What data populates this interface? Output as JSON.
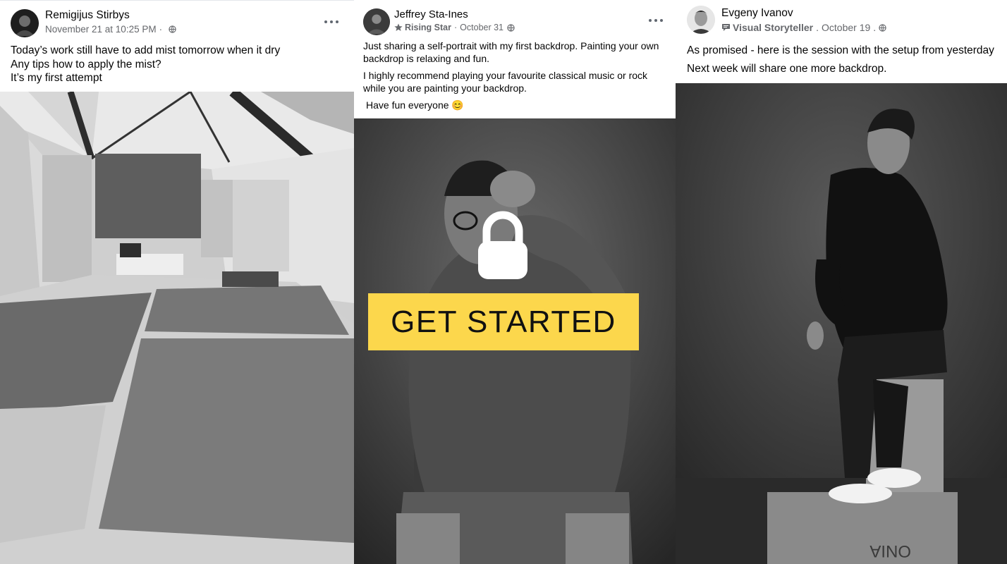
{
  "posts": [
    {
      "author": "Remigijus Stirbys",
      "timestamp": "November 21 at 10:25 PM",
      "separator": "·",
      "privacy_icon": "globe-icon",
      "more_icon": "more-options-icon",
      "lines": [
        "Today’s work still have to add mist tomorrow when it dry",
        "Any tips how to apply the mist?",
        "It’s my first attempt"
      ],
      "photo": "studio-floor-backdrop-photo"
    },
    {
      "author": "Jeffrey Sta-Ines",
      "badge_icon": "star-icon",
      "badge": "Rising Star",
      "separator": "·",
      "timestamp": "October 31",
      "privacy_icon": "globe-icon",
      "more_icon": "more-options-icon",
      "paragraphs": [
        "Just sharing a self-portrait with my first backdrop. Painting your own backdrop is relaxing and fun.",
        "I highly recommend playing your favourite classical music or rock while you are painting your backdrop.",
        "Have fun everyone 😊"
      ],
      "photo": "self-portrait-photo"
    },
    {
      "author": "Evgeny Ivanov",
      "badge_icon": "speech-bubble-icon",
      "badge": "Visual Storyteller",
      "separator": ".",
      "timestamp": "October 19",
      "separator2": ".",
      "privacy_icon": "globe-icon",
      "lines": [
        "As promised - here is the session with the setup from yesterday",
        "Next week will share one more backdrop."
      ],
      "photo": "seated-model-photo",
      "crate_text": "ONIA"
    }
  ],
  "overlay": {
    "lock_icon": "lock-icon",
    "cta_label": "GET STARTED",
    "cta_color": "#fcd74c"
  },
  "colors": {
    "meta_gray": "#65676b",
    "text": "#050505"
  }
}
